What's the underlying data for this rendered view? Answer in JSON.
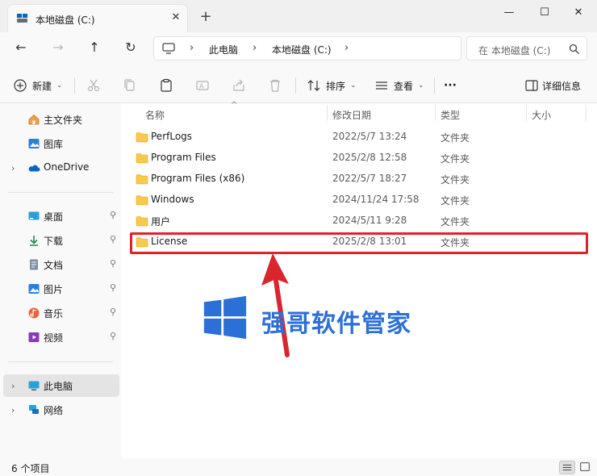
{
  "window": {
    "tab_title": "本地磁盘 (C:)",
    "new_tab": "+",
    "tab_close": "✕",
    "minimize": "—",
    "maximize": "☐",
    "close": "✕"
  },
  "nav": {
    "back": "←",
    "forward": "→",
    "up": "↑",
    "refresh": "↻",
    "breadcrumb": [
      "此电脑",
      "本地磁盘 (C:)"
    ],
    "separator": "›",
    "search_placeholder": "在 本地磁盘 (C:)"
  },
  "toolbar": {
    "new_label": "新建",
    "sort_label": "排序",
    "view_label": "查看",
    "more_label": "···",
    "details_label": "详细信息"
  },
  "sidebar": {
    "items": [
      {
        "label": "主文件夹",
        "icon": "home-icon"
      },
      {
        "label": "图库",
        "icon": "gallery-icon"
      },
      {
        "label": "OneDrive",
        "icon": "cloud-icon"
      },
      {
        "label": "桌面",
        "icon": "desktop-icon"
      },
      {
        "label": "下载",
        "icon": "download-icon"
      },
      {
        "label": "文档",
        "icon": "document-icon"
      },
      {
        "label": "图片",
        "icon": "picture-icon"
      },
      {
        "label": "音乐",
        "icon": "music-icon"
      },
      {
        "label": "视频",
        "icon": "video-icon"
      },
      {
        "label": "此电脑",
        "icon": "pc-icon"
      },
      {
        "label": "网络",
        "icon": "network-icon"
      }
    ],
    "expander": "›",
    "pin": "📌"
  },
  "columns": {
    "name": "名称",
    "date": "修改日期",
    "type": "类型",
    "size": "大小",
    "sort_indicator": "^"
  },
  "files": [
    {
      "name": "PerfLogs",
      "date": "2022/5/7 13:24",
      "type": "文件夹"
    },
    {
      "name": "Program Files",
      "date": "2025/2/8 12:58",
      "type": "文件夹"
    },
    {
      "name": "Program Files (x86)",
      "date": "2022/5/7 18:27",
      "type": "文件夹"
    },
    {
      "name": "Windows",
      "date": "2024/11/24 17:58",
      "type": "文件夹"
    },
    {
      "name": "用户",
      "date": "2024/5/11 9:28",
      "type": "文件夹"
    },
    {
      "name": "License",
      "date": "2025/2/8 13:01",
      "type": "文件夹"
    }
  ],
  "watermark": {
    "text": "强哥软件管家"
  },
  "status": {
    "item_count": "6 个项目"
  },
  "colors": {
    "highlight": "#e0232b",
    "accent": "#0067c0",
    "folder": "#f8c94a",
    "watermark": "#2c6fd6"
  }
}
